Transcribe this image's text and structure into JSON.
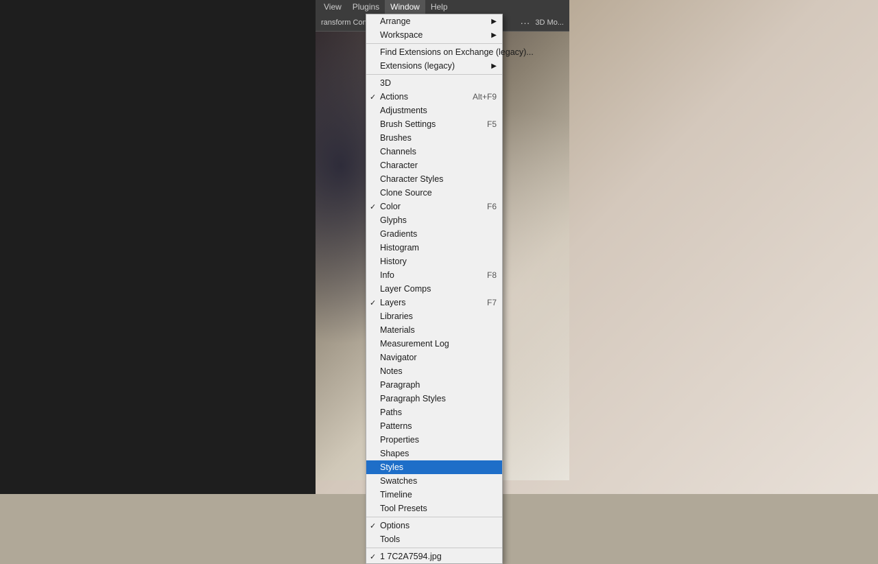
{
  "menubar": {
    "items": [
      "View",
      "Plugins",
      "Window",
      "Help"
    ]
  },
  "optionsbar": {
    "transform_label": "ransform Controls",
    "dots": "...",
    "mode_label": "3D Mo..."
  },
  "menu": {
    "sections": [
      {
        "items": [
          {
            "label": "Arrange",
            "shortcut": "",
            "arrow": true,
            "checked": false,
            "id": "arrange"
          },
          {
            "label": "Workspace",
            "shortcut": "",
            "arrow": true,
            "checked": false,
            "id": "workspace"
          }
        ]
      },
      {
        "separator": true,
        "items": [
          {
            "label": "Find Extensions on Exchange (legacy)...",
            "shortcut": "",
            "arrow": false,
            "checked": false,
            "id": "find-extensions"
          },
          {
            "label": "Extensions (legacy)",
            "shortcut": "",
            "arrow": true,
            "checked": false,
            "id": "extensions-legacy"
          }
        ]
      },
      {
        "separator": true,
        "items": [
          {
            "label": "3D",
            "shortcut": "",
            "arrow": false,
            "checked": false,
            "id": "3d"
          },
          {
            "label": "Actions",
            "shortcut": "Alt+F9",
            "arrow": false,
            "checked": true,
            "id": "actions"
          },
          {
            "label": "Adjustments",
            "shortcut": "",
            "arrow": false,
            "checked": false,
            "id": "adjustments"
          },
          {
            "label": "Brush Settings",
            "shortcut": "F5",
            "arrow": false,
            "checked": false,
            "id": "brush-settings"
          },
          {
            "label": "Brushes",
            "shortcut": "",
            "arrow": false,
            "checked": false,
            "id": "brushes"
          },
          {
            "label": "Channels",
            "shortcut": "",
            "arrow": false,
            "checked": false,
            "id": "channels"
          },
          {
            "label": "Character",
            "shortcut": "",
            "arrow": false,
            "checked": false,
            "id": "character"
          },
          {
            "label": "Character Styles",
            "shortcut": "",
            "arrow": false,
            "checked": false,
            "id": "character-styles"
          },
          {
            "label": "Clone Source",
            "shortcut": "",
            "arrow": false,
            "checked": false,
            "id": "clone-source"
          },
          {
            "label": "Color",
            "shortcut": "F6",
            "arrow": false,
            "checked": true,
            "id": "color"
          },
          {
            "label": "Glyphs",
            "shortcut": "",
            "arrow": false,
            "checked": false,
            "id": "glyphs"
          },
          {
            "label": "Gradients",
            "shortcut": "",
            "arrow": false,
            "checked": false,
            "id": "gradients"
          },
          {
            "label": "Histogram",
            "shortcut": "",
            "arrow": false,
            "checked": false,
            "id": "histogram"
          },
          {
            "label": "History",
            "shortcut": "",
            "arrow": false,
            "checked": false,
            "id": "history"
          },
          {
            "label": "Info",
            "shortcut": "F8",
            "arrow": false,
            "checked": false,
            "id": "info"
          },
          {
            "label": "Layer Comps",
            "shortcut": "",
            "arrow": false,
            "checked": false,
            "id": "layer-comps"
          },
          {
            "label": "Layers",
            "shortcut": "F7",
            "arrow": false,
            "checked": true,
            "id": "layers"
          },
          {
            "label": "Libraries",
            "shortcut": "",
            "arrow": false,
            "checked": false,
            "id": "libraries"
          },
          {
            "label": "Materials",
            "shortcut": "",
            "arrow": false,
            "checked": false,
            "id": "materials"
          },
          {
            "label": "Measurement Log",
            "shortcut": "",
            "arrow": false,
            "checked": false,
            "id": "measurement-log"
          },
          {
            "label": "Navigator",
            "shortcut": "",
            "arrow": false,
            "checked": false,
            "id": "navigator"
          },
          {
            "label": "Notes",
            "shortcut": "",
            "arrow": false,
            "checked": false,
            "id": "notes"
          },
          {
            "label": "Paragraph",
            "shortcut": "",
            "arrow": false,
            "checked": false,
            "id": "paragraph"
          },
          {
            "label": "Paragraph Styles",
            "shortcut": "",
            "arrow": false,
            "checked": false,
            "id": "paragraph-styles"
          },
          {
            "label": "Paths",
            "shortcut": "",
            "arrow": false,
            "checked": false,
            "id": "paths"
          },
          {
            "label": "Patterns",
            "shortcut": "",
            "arrow": false,
            "checked": false,
            "id": "patterns"
          },
          {
            "label": "Properties",
            "shortcut": "",
            "arrow": false,
            "checked": false,
            "id": "properties"
          },
          {
            "label": "Shapes",
            "shortcut": "",
            "arrow": false,
            "checked": false,
            "id": "shapes"
          },
          {
            "label": "Styles",
            "shortcut": "",
            "arrow": false,
            "checked": false,
            "id": "styles",
            "highlighted": true
          },
          {
            "label": "Swatches",
            "shortcut": "",
            "arrow": false,
            "checked": false,
            "id": "swatches"
          },
          {
            "label": "Timeline",
            "shortcut": "",
            "arrow": false,
            "checked": false,
            "id": "timeline"
          },
          {
            "label": "Tool Presets",
            "shortcut": "",
            "arrow": false,
            "checked": false,
            "id": "tool-presets"
          }
        ]
      },
      {
        "separator": true,
        "items": [
          {
            "label": "Options",
            "shortcut": "",
            "arrow": false,
            "checked": true,
            "id": "options"
          },
          {
            "label": "Tools",
            "shortcut": "",
            "arrow": false,
            "checked": false,
            "id": "tools"
          }
        ]
      },
      {
        "separator": true,
        "items": [
          {
            "label": "✓ 1 7C2A7594.jpg",
            "shortcut": "",
            "arrow": false,
            "checked": false,
            "id": "file1",
            "raw": true
          }
        ]
      }
    ]
  },
  "status": {
    "filename": "1 7C2A7594.jpg"
  }
}
